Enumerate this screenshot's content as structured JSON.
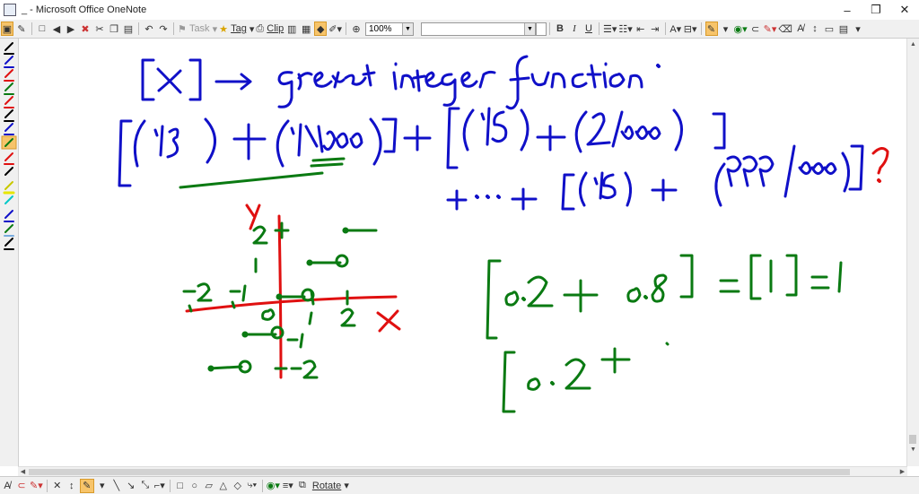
{
  "window": {
    "title": "_ - Microsoft Office OneNote",
    "controls": {
      "minimize": "–",
      "restore": "❐",
      "close": "✕"
    }
  },
  "toolbar": {
    "task_label": "Task",
    "tag_label": "Tag",
    "clip_label": "Clip",
    "zoom_value": "100%",
    "bold": "B",
    "italic": "I",
    "underline": "U"
  },
  "bottombar": {
    "rotate_label": "Rotate"
  },
  "ink_colors": {
    "blue": "#1010c8",
    "green": "#0a7a12",
    "red": "#e01010"
  },
  "handwriting": {
    "line1": "[x] → greatest integer function .",
    "line2": "[(1/5) + (1/1000)] + [(1/5) + (2/1000)]",
    "line3": "+ ... + [(1/5) + (999/1000)] ?",
    "eq1": "[0·2 + 0·8] = [1] = 1",
    "eq2": "[0·2 +",
    "graph_y_label": "Y",
    "graph_x_label": "X",
    "tick_labels": [
      "2",
      "1",
      "-2",
      "-1",
      "0",
      "1",
      "2",
      "-1",
      "-2"
    ]
  }
}
